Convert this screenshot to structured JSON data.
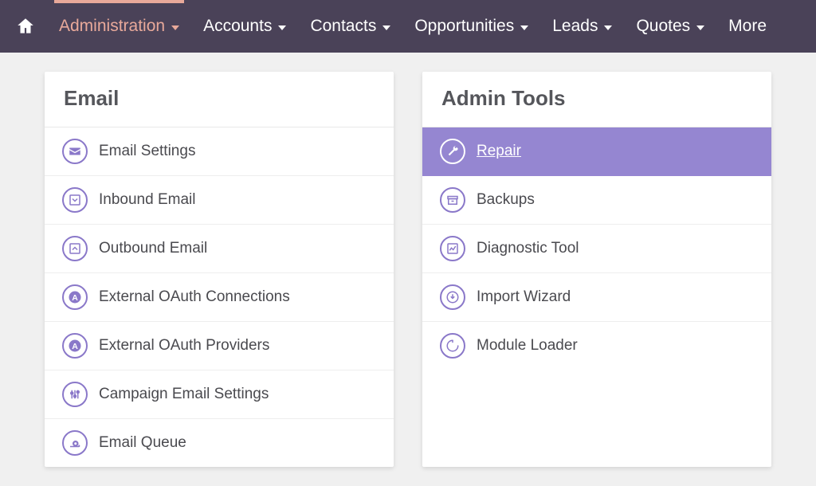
{
  "nav": {
    "items": [
      {
        "label": "Administration",
        "active": true,
        "caret": true
      },
      {
        "label": "Accounts",
        "active": false,
        "caret": true
      },
      {
        "label": "Contacts",
        "active": false,
        "caret": true
      },
      {
        "label": "Opportunities",
        "active": false,
        "caret": true
      },
      {
        "label": "Leads",
        "active": false,
        "caret": true
      },
      {
        "label": "Quotes",
        "active": false,
        "caret": true
      },
      {
        "label": "More",
        "active": false,
        "caret": false
      }
    ]
  },
  "panels": {
    "email": {
      "title": "Email",
      "items": [
        {
          "label": "Email Settings",
          "icon": "envelope-icon"
        },
        {
          "label": "Inbound Email",
          "icon": "inbox-icon"
        },
        {
          "label": "Outbound Email",
          "icon": "outbox-icon"
        },
        {
          "label": "External OAuth Connections",
          "icon": "oauth-icon"
        },
        {
          "label": "External OAuth Providers",
          "icon": "oauth-icon"
        },
        {
          "label": "Campaign Email Settings",
          "icon": "sliders-icon"
        },
        {
          "label": "Email Queue",
          "icon": "snail-icon"
        }
      ]
    },
    "admin": {
      "title": "Admin Tools",
      "items": [
        {
          "label": "Repair",
          "icon": "wrench-icon",
          "selected": true
        },
        {
          "label": "Backups",
          "icon": "archive-icon"
        },
        {
          "label": "Diagnostic Tool",
          "icon": "chart-icon"
        },
        {
          "label": "Import Wizard",
          "icon": "import-icon"
        },
        {
          "label": "Module Loader",
          "icon": "loader-icon"
        }
      ]
    }
  }
}
